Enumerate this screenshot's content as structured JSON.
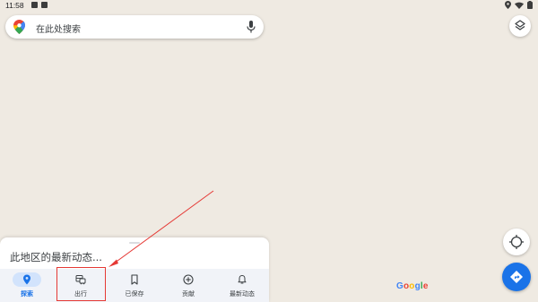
{
  "status_bar": {
    "time": "11:58"
  },
  "search": {
    "placeholder": "在此处搜索"
  },
  "sheet": {
    "title": "此地区的最新动态..."
  },
  "brand": {
    "logo": "Google"
  },
  "nav": [
    {
      "label": "探索",
      "icon": "location-pin-icon",
      "active": true
    },
    {
      "label": "出行",
      "icon": "commute-icon",
      "active": false
    },
    {
      "label": "已保存",
      "icon": "bookmark-icon",
      "active": false
    },
    {
      "label": "贡献",
      "icon": "add-circle-icon",
      "active": false
    },
    {
      "label": "最新动态",
      "icon": "bell-icon",
      "active": false
    }
  ],
  "colors": {
    "map_bg": "#efeae2",
    "accent": "#1a73e8",
    "annotation": "#e53935"
  }
}
